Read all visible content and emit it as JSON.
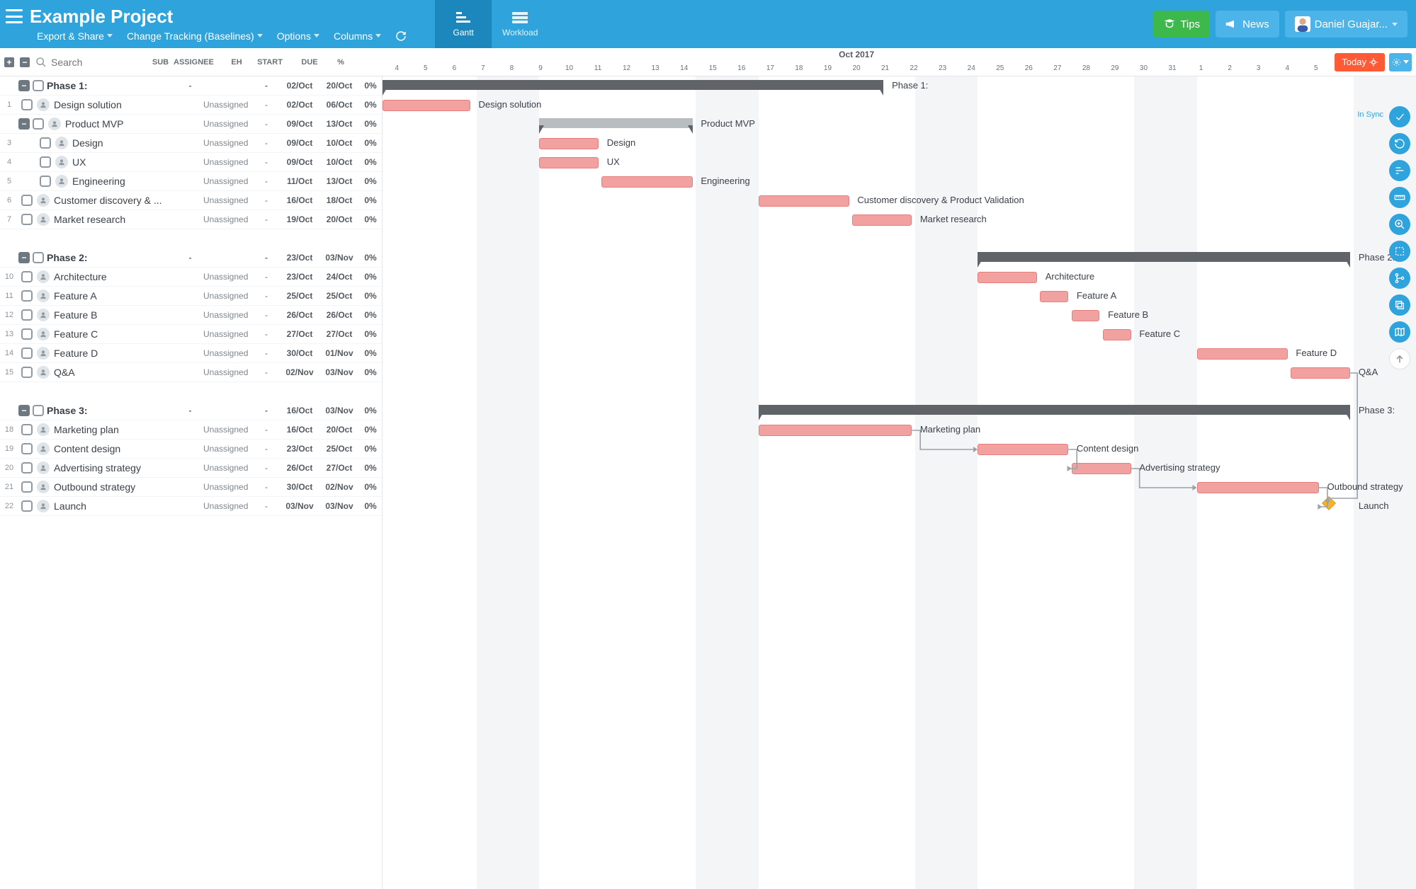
{
  "project_title": "Example Project",
  "menu": {
    "export": "Export & Share",
    "change_tracking": "Change Tracking (Baselines)",
    "options": "Options",
    "columns": "Columns"
  },
  "view_tabs": {
    "gantt": "Gantt",
    "workload": "Workload"
  },
  "top_buttons": {
    "tips": "Tips",
    "news": "News"
  },
  "user_name": "Daniel Guajar...",
  "search_placeholder": "Search",
  "col_heads": {
    "sub": "SUB",
    "assignee": "ASSIGNEE",
    "eh": "EH",
    "start": "START",
    "due": "DUE",
    "pct": "%"
  },
  "timeline": {
    "month": "Oct 2017",
    "days": [
      "4",
      "5",
      "6",
      "7",
      "8",
      "9",
      "10",
      "11",
      "12",
      "13",
      "14",
      "15",
      "16",
      "17",
      "18",
      "19",
      "20",
      "21",
      "22",
      "23",
      "24",
      "25",
      "26",
      "27",
      "28",
      "29",
      "30",
      "31",
      "1",
      "2",
      "3",
      "4",
      "5"
    ],
    "weekend_idx": [
      3,
      4,
      10,
      11,
      17,
      18,
      24,
      25,
      31,
      32
    ]
  },
  "today_btn": "Today",
  "sync_label": "In Sync",
  "day_width_pct": 3.0303,
  "tasks": [
    {
      "type": "phase",
      "toggle": true,
      "name": "Phase 1:",
      "sub": "-",
      "assignee": "",
      "eh": "-",
      "start": "02/Oct",
      "due": "20/Oct",
      "pct": "0%",
      "gstart": 0,
      "gend": 16
    },
    {
      "type": "task",
      "num": "1",
      "indent": 0,
      "name": "Design solution",
      "sub": "",
      "assignee": "Unassigned",
      "eh": "-",
      "start": "02/Oct",
      "due": "06/Oct",
      "pct": "0%",
      "gstart": 0,
      "gend": 2.8
    },
    {
      "type": "group",
      "toggle": true,
      "num": "",
      "indent": 0,
      "name": "Product MVP",
      "sub": "",
      "assignee": "Unassigned",
      "eh": "-",
      "start": "09/Oct",
      "due": "13/Oct",
      "pct": "0%",
      "gstart": 5,
      "gend": 9.9
    },
    {
      "type": "task",
      "num": "3",
      "indent": 1,
      "name": "Design",
      "sub": "",
      "assignee": "Unassigned",
      "eh": "-",
      "start": "09/Oct",
      "due": "10/Oct",
      "pct": "0%",
      "gstart": 5,
      "gend": 6.9
    },
    {
      "type": "task",
      "num": "4",
      "indent": 1,
      "name": "UX",
      "sub": "",
      "assignee": "Unassigned",
      "eh": "-",
      "start": "09/Oct",
      "due": "10/Oct",
      "pct": "0%",
      "gstart": 5,
      "gend": 6.9
    },
    {
      "type": "task",
      "num": "5",
      "indent": 1,
      "name": "Engineering",
      "sub": "",
      "assignee": "Unassigned",
      "eh": "-",
      "start": "11/Oct",
      "due": "13/Oct",
      "pct": "0%",
      "gstart": 7,
      "gend": 9.9
    },
    {
      "type": "task",
      "num": "6",
      "indent": 0,
      "name": "Customer discovery & ...",
      "glabel": "Customer discovery & Product Validation",
      "sub": "",
      "assignee": "Unassigned",
      "eh": "-",
      "start": "16/Oct",
      "due": "18/Oct",
      "pct": "0%",
      "gstart": 12,
      "gend": 14.9
    },
    {
      "type": "task",
      "num": "7",
      "indent": 0,
      "name": "Market research",
      "sub": "",
      "assignee": "Unassigned",
      "eh": "-",
      "start": "19/Oct",
      "due": "20/Oct",
      "pct": "0%",
      "gstart": 15,
      "gend": 16.9
    },
    {
      "type": "spacer"
    },
    {
      "type": "phase",
      "toggle": true,
      "name": "Phase 2:",
      "sub": "-",
      "assignee": "",
      "eh": "-",
      "start": "23/Oct",
      "due": "03/Nov",
      "pct": "0%",
      "gstart": 19,
      "gend": 30.9
    },
    {
      "type": "task",
      "num": "10",
      "indent": 0,
      "name": "Architecture",
      "sub": "",
      "assignee": "Unassigned",
      "eh": "-",
      "start": "23/Oct",
      "due": "24/Oct",
      "pct": "0%",
      "gstart": 19,
      "gend": 20.9
    },
    {
      "type": "task",
      "num": "11",
      "indent": 0,
      "name": "Feature A",
      "sub": "",
      "assignee": "Unassigned",
      "eh": "-",
      "start": "25/Oct",
      "due": "25/Oct",
      "pct": "0%",
      "gstart": 21,
      "gend": 21.9
    },
    {
      "type": "task",
      "num": "12",
      "indent": 0,
      "name": "Feature B",
      "sub": "",
      "assignee": "Unassigned",
      "eh": "-",
      "start": "26/Oct",
      "due": "26/Oct",
      "pct": "0%",
      "gstart": 22,
      "gend": 22.9
    },
    {
      "type": "task",
      "num": "13",
      "indent": 0,
      "name": "Feature C",
      "sub": "",
      "assignee": "Unassigned",
      "eh": "-",
      "start": "27/Oct",
      "due": "27/Oct",
      "pct": "0%",
      "gstart": 23,
      "gend": 23.9
    },
    {
      "type": "task",
      "num": "14",
      "indent": 0,
      "name": "Feature D",
      "sub": "",
      "assignee": "Unassigned",
      "eh": "-",
      "start": "30/Oct",
      "due": "01/Nov",
      "pct": "0%",
      "gstart": 26,
      "gend": 28.9
    },
    {
      "type": "task",
      "num": "15",
      "indent": 0,
      "name": "Q&A",
      "sub": "",
      "assignee": "Unassigned",
      "eh": "-",
      "start": "02/Nov",
      "due": "03/Nov",
      "pct": "0%",
      "gstart": 29,
      "gend": 30.9
    },
    {
      "type": "spacer"
    },
    {
      "type": "phase",
      "toggle": true,
      "name": "Phase 3:",
      "sub": "-",
      "assignee": "",
      "eh": "-",
      "start": "16/Oct",
      "due": "03/Nov",
      "pct": "0%",
      "gstart": 12,
      "gend": 30.9
    },
    {
      "type": "task",
      "num": "18",
      "indent": 0,
      "name": "Marketing plan",
      "sub": "",
      "assignee": "Unassigned",
      "eh": "-",
      "start": "16/Oct",
      "due": "20/Oct",
      "pct": "0%",
      "gstart": 12,
      "gend": 16.9,
      "dep_to_next": true
    },
    {
      "type": "task",
      "num": "19",
      "indent": 0,
      "name": "Content design",
      "sub": "",
      "assignee": "Unassigned",
      "eh": "-",
      "start": "23/Oct",
      "due": "25/Oct",
      "pct": "0%",
      "gstart": 19,
      "gend": 21.9,
      "dep_to_next": true
    },
    {
      "type": "task",
      "num": "20",
      "indent": 0,
      "name": "Advertising strategy",
      "sub": "",
      "assignee": "Unassigned",
      "eh": "-",
      "start": "26/Oct",
      "due": "27/Oct",
      "pct": "0%",
      "gstart": 22,
      "gend": 23.9,
      "dep_to_next": true
    },
    {
      "type": "task",
      "num": "21",
      "indent": 0,
      "name": "Outbound strategy",
      "sub": "",
      "assignee": "Unassigned",
      "eh": "-",
      "start": "30/Oct",
      "due": "02/Nov",
      "pct": "0%",
      "gstart": 26,
      "gend": 29.9,
      "dep_to_next": true
    },
    {
      "type": "milestone",
      "num": "22",
      "indent": 0,
      "name": "Launch",
      "sub": "",
      "assignee": "Unassigned",
      "eh": "-",
      "start": "03/Nov",
      "due": "03/Nov",
      "pct": "0%",
      "gstart": 30
    }
  ],
  "extra_deps": [
    {
      "from_row": 15,
      "to_row": 22,
      "from_end": 30.9,
      "to_start": 30
    }
  ],
  "fab_icons": [
    "check",
    "rotate",
    "align",
    "ruler",
    "zoom",
    "select",
    "branch",
    "copy",
    "map",
    "up"
  ]
}
